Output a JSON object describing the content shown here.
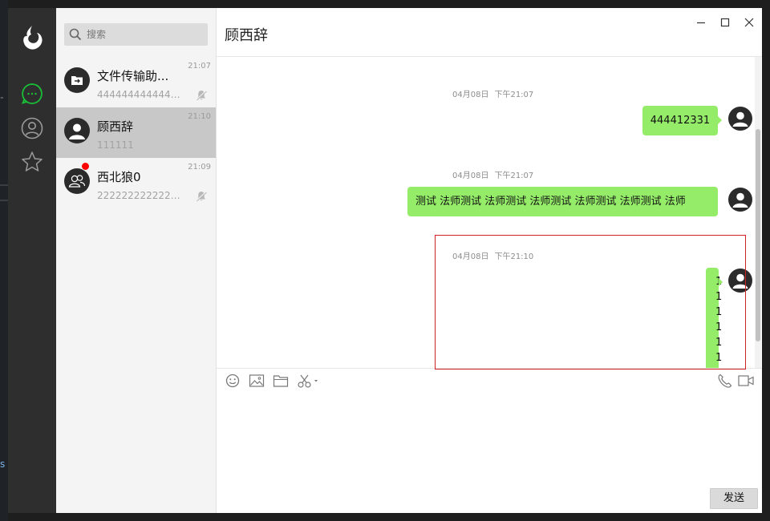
{
  "window": {
    "title": "顾西辞"
  },
  "search": {
    "placeholder": "搜索"
  },
  "nav": {
    "items": [
      {
        "icon": "chat-bubble-icon",
        "active": true
      },
      {
        "icon": "contacts-icon",
        "active": false
      },
      {
        "icon": "favorites-star-icon",
        "active": false
      }
    ],
    "accent": "#19c037"
  },
  "conversations": [
    {
      "name": "文件传输助...",
      "preview": "44444444444444...",
      "time": "21:07",
      "icon": "file-transfer-icon",
      "muted": true,
      "unread": false
    },
    {
      "name": "顾西辞",
      "preview": "111111",
      "time": "21:10",
      "icon": "user-avatar-icon",
      "muted": false,
      "unread": false,
      "active": true
    },
    {
      "name": "西北狼0",
      "preview": "22222222222222...",
      "time": "21:09",
      "icon": "group-avatar-icon",
      "muted": true,
      "unread": true
    }
  ],
  "messages": [
    {
      "date": "04月08日",
      "time": "下午21:07",
      "text": "444412331",
      "outgoing": true
    },
    {
      "date": "04月08日",
      "time": "下午21:07",
      "text": "测试  法师测试  法师测试  法师测试  法师测试  法师测试  法师",
      "outgoing": true
    },
    {
      "date": "04月08日",
      "time": "下午21:10",
      "lines": [
        "1",
        "1",
        "1",
        "1",
        "1",
        "1"
      ],
      "outgoing": true
    }
  ],
  "composer": {
    "send_label": "发送",
    "value": ""
  },
  "colors": {
    "bubble": "#95ec69",
    "sidebar": "#2e2e2e",
    "list_bg": "#f4f4f4",
    "active_item": "#c8c8c8",
    "highlight_box": "#d32020"
  }
}
